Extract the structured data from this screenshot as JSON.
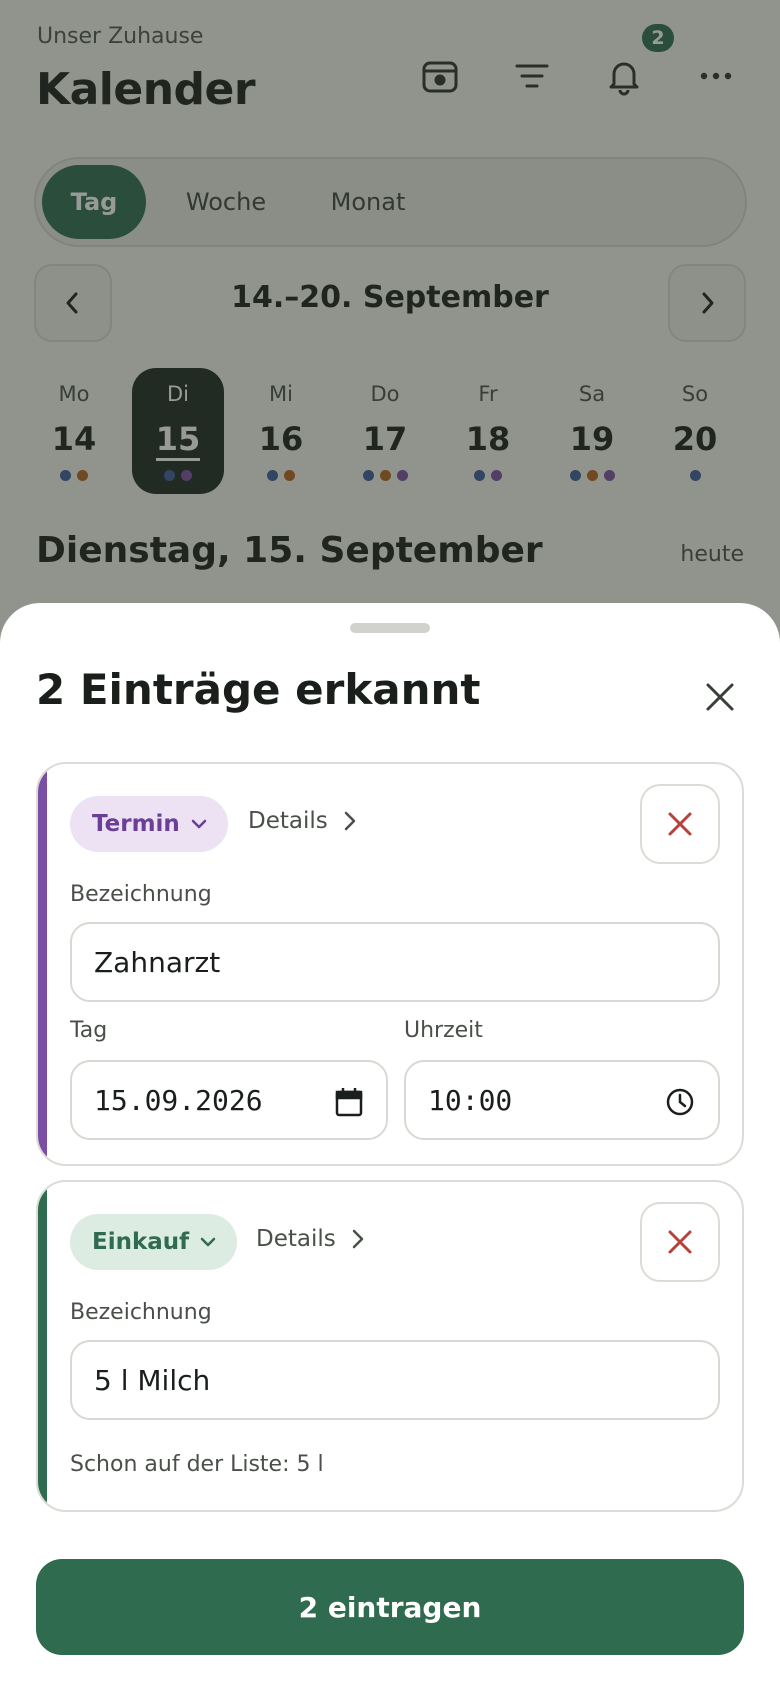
{
  "header": {
    "household": "Unser Zuhause",
    "title": "Kalender",
    "notification_count": "2"
  },
  "view_tabs": [
    {
      "label": "Tag",
      "active": true
    },
    {
      "label": "Woche",
      "active": false
    },
    {
      "label": "Monat",
      "active": false
    }
  ],
  "week_range": "14.–20. September",
  "days": [
    {
      "name": "Mo",
      "num": "14",
      "dots": [
        "#3d5f9c",
        "#b5651d"
      ]
    },
    {
      "name": "Di",
      "num": "15",
      "selected": true,
      "dots": [
        "#3d5f9c",
        "#7b4fa6"
      ]
    },
    {
      "name": "Mi",
      "num": "16",
      "dots": [
        "#3d5f9c",
        "#b5651d"
      ]
    },
    {
      "name": "Do",
      "num": "17",
      "dots": [
        "#3d5f9c",
        "#b5651d",
        "#7b4fa6"
      ]
    },
    {
      "name": "Fr",
      "num": "18",
      "dots": [
        "#3d5f9c",
        "#7b4fa6"
      ]
    },
    {
      "name": "Sa",
      "num": "19",
      "dots": [
        "#3d5f9c",
        "#b5651d",
        "#7b4fa6"
      ]
    },
    {
      "name": "So",
      "num": "20",
      "dots": [
        "#3d5f9c"
      ]
    }
  ],
  "selected_date_heading": "Dienstag, 15. September",
  "today_link": "heute",
  "sheet": {
    "title": "2 Einträge erkannt",
    "entries": [
      {
        "type_label": "Termin",
        "accent": "#7b4fa6",
        "chip_bg": "#ece2f3",
        "details_label": "Details",
        "name_label": "Bezeichnung",
        "name_value": "Zahnarzt",
        "day_label": "Tag",
        "day_value": "15.09.2026",
        "time_label": "Uhrzeit",
        "time_value": "10:00"
      },
      {
        "type_label": "Einkauf",
        "accent": "#2f6b4f",
        "chip_bg": "#dcece2",
        "details_label": "Details",
        "name_label": "Bezeichnung",
        "name_value": "5 l Milch",
        "hint": "Schon auf der Liste: 5 l"
      }
    ],
    "submit_label": "2 eintragen"
  },
  "colors": {
    "primary": "#2f6b4f",
    "danger": "#b8423a",
    "termin": "#7b4fa6",
    "einkauf": "#2f6b4f"
  }
}
